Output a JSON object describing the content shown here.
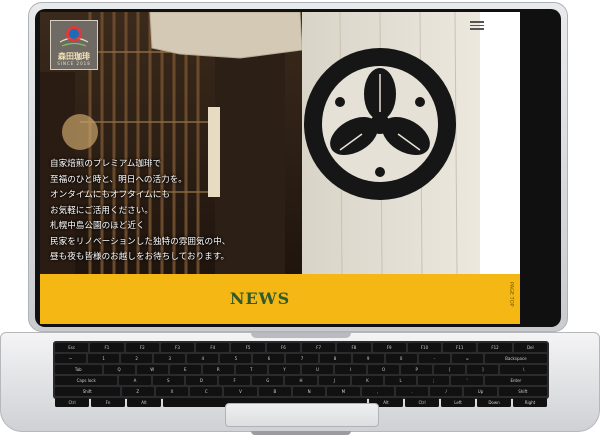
{
  "site": {
    "logo": {
      "brand": "森田珈琲",
      "since": "SINCE 2018",
      "emblem": "coffee-roaster-emblem"
    },
    "menu_icon": "hamburger-menu-icon",
    "hero_copy": [
      "自家焙煎のプレミアム珈琲で",
      "至福のひと時と、明日への活力を。",
      "オンタイムにもオフタイムにも",
      "お気軽にご活用ください。",
      "札幌中島公園のほど近く",
      "民家をリノベーションした独特の雰囲気の中、",
      "昼も夜も皆様のお越しをお待ちしております。"
    ],
    "news": {
      "title": "NEWS",
      "side_tab": "PAGE TOP"
    }
  },
  "keyboard": {
    "rows": [
      [
        "Esc",
        "F1",
        "F2",
        "F3",
        "F4",
        "F5",
        "F6",
        "F7",
        "F8",
        "F9",
        "F10",
        "F11",
        "F12",
        "Del"
      ],
      [
        "~",
        "1",
        "2",
        "3",
        "4",
        "5",
        "6",
        "7",
        "8",
        "9",
        "0",
        "-",
        "=",
        "Backspace"
      ],
      [
        "Tab",
        "Q",
        "W",
        "E",
        "R",
        "T",
        "Y",
        "U",
        "I",
        "O",
        "P",
        "[",
        "]",
        "\\"
      ],
      [
        "Caps lock",
        "A",
        "S",
        "D",
        "F",
        "G",
        "H",
        "J",
        "K",
        "L",
        ";",
        "'",
        "Enter"
      ],
      [
        "Shift",
        "Z",
        "X",
        "C",
        "V",
        "B",
        "N",
        "M",
        ",",
        ".",
        "/",
        "Up",
        "Shift"
      ],
      [
        "Ctrl",
        "Fn",
        "Alt",
        "",
        "Alt",
        "Ctrl",
        "Left",
        "Down",
        "Right"
      ]
    ]
  },
  "colors": {
    "news_band": "#f5b714",
    "news_title": "#2f5a2c",
    "bezel": "#101010"
  }
}
